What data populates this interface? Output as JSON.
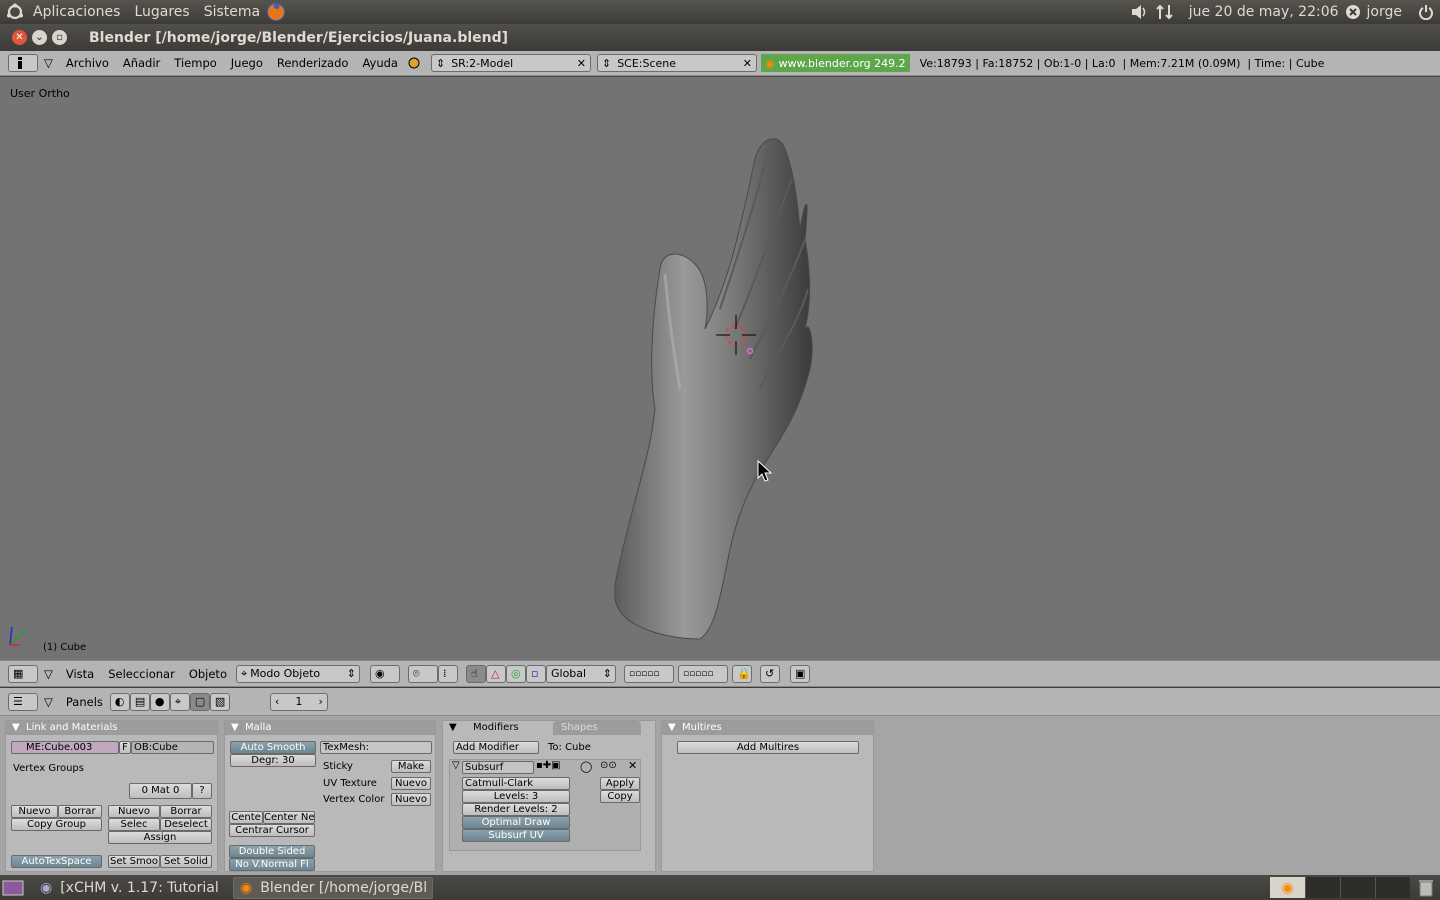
{
  "top_panel": {
    "menus": [
      "Aplicaciones",
      "Lugares",
      "Sistema"
    ],
    "datetime": "jue 20 de may, 22:06",
    "user": "jorge"
  },
  "window": {
    "title": "Blender [/home/jorge/Blender/Ejercicios/Juana.blend]"
  },
  "info_header": {
    "menus": [
      "Archivo",
      "Añadir",
      "Tiempo",
      "Juego",
      "Renderizado",
      "Ayuda"
    ],
    "screen": "SR:2-Model",
    "scene": "SCE:Scene",
    "version_link": "www.blender.org 249.2",
    "stats": "Ve:18793 | Fa:18752 | Ob:1-0 | La:0  | Mem:7.21M (0.09M)  | Time: | Cube"
  },
  "viewport": {
    "view_label": "User Ortho",
    "object_label": "(1) Cube"
  },
  "viewport_header": {
    "menus": [
      "Vista",
      "Seleccionar",
      "Objeto"
    ],
    "mode": "Modo Objeto",
    "orientation": "Global"
  },
  "buttons_header": {
    "panels_label": "Panels",
    "frame": "1"
  },
  "link_materials": {
    "title": "Link and Materials",
    "mesh_name": "ME:Cube.003",
    "f_label": "F",
    "ob_name": "OB:Cube",
    "vertex_groups": "Vertex Groups",
    "mat_field": "0 Mat 0",
    "question": "?",
    "nuevo1": "Nuevo",
    "borrar1": "Borrar",
    "copy_group": "Copy Group",
    "nuevo2": "Nuevo",
    "borrar2": "Borrar",
    "selec": "Selec",
    "deselect": "Deselect",
    "assign": "Assign",
    "autotexspace": "AutoTexSpace",
    "set_smooth": "Set Smoo",
    "set_solid": "Set Solid"
  },
  "malla": {
    "title": "Malla",
    "auto_smooth": "Auto Smooth",
    "degr": "Degr: 30",
    "texmesh": "TexMesh:",
    "sticky": "Sticky",
    "make": "Make",
    "uv_texture": "UV Texture",
    "nuevo_uv": "Nuevo",
    "vertex_color": "Vertex Color",
    "nuevo_vc": "Nuevo",
    "center": "Cente",
    "center_new": "Center Ne",
    "centrar_cursor": "Centrar Cursor",
    "double_sided": "Double Sided",
    "no_vnormal": "No V.Normal Fl"
  },
  "modifiers": {
    "tab_modifiers": "Modifiers",
    "tab_shapes": "Shapes",
    "add_modifier": "Add Modifier",
    "to": "To: Cube",
    "subsurf": "Subsurf",
    "type": "Catmull-Clark",
    "levels": "Levels: 3",
    "render_levels": "Render Levels: 2",
    "optimal_draw": "Optimal Draw",
    "subsurf_uv": "Subsurf UV",
    "apply": "Apply",
    "copy": "Copy"
  },
  "multires": {
    "title": "Multires",
    "add": "Add Multires"
  },
  "taskbar": {
    "tasks": [
      "[xCHM v. 1.17: Tutorial ...",
      "Blender [/home/jorge/Bl..."
    ]
  }
}
